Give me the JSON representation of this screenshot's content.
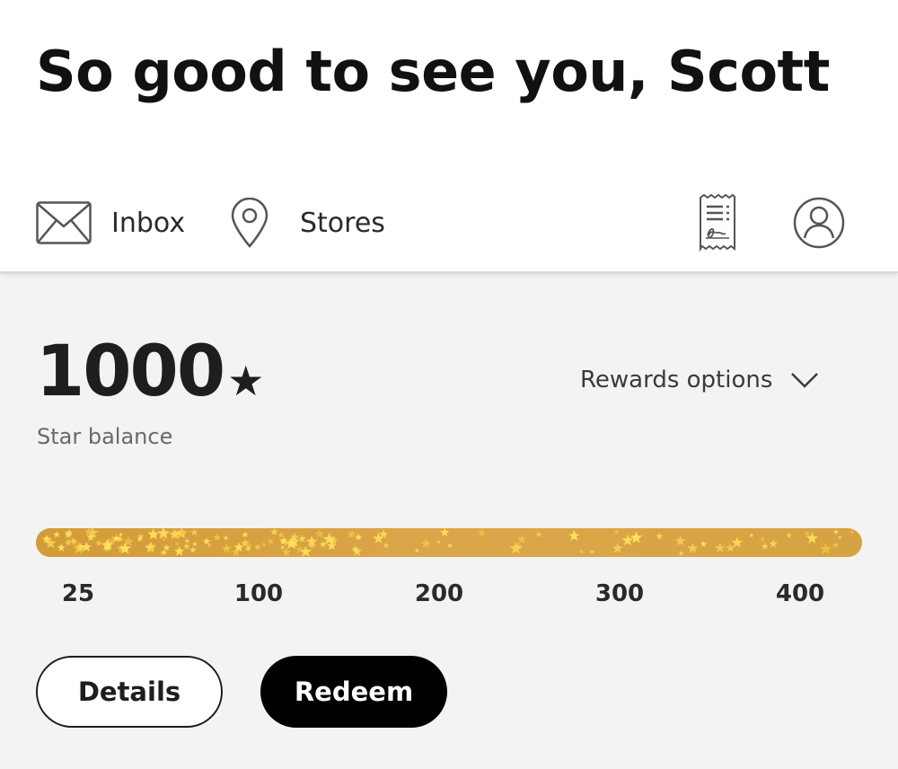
{
  "header": {
    "greeting": "So good to see you, Scott"
  },
  "nav": {
    "inbox_label": "Inbox",
    "stores_label": "Stores",
    "icons": [
      "envelope-icon",
      "location-pin-icon",
      "receipt-icon",
      "account-icon"
    ]
  },
  "rewards": {
    "balance": "1000",
    "star_glyph": "★",
    "balance_label": "Star balance",
    "options_label": "Rewards options",
    "progress_fraction": 1.0,
    "tiers": [
      "25",
      "100",
      "200",
      "300",
      "400"
    ]
  },
  "actions": {
    "details_label": "Details",
    "redeem_label": "Redeem"
  },
  "colors": {
    "bar_gold": "#d4a040",
    "star_yellow": "#ffe45c",
    "redeem_bg": "#000000"
  }
}
